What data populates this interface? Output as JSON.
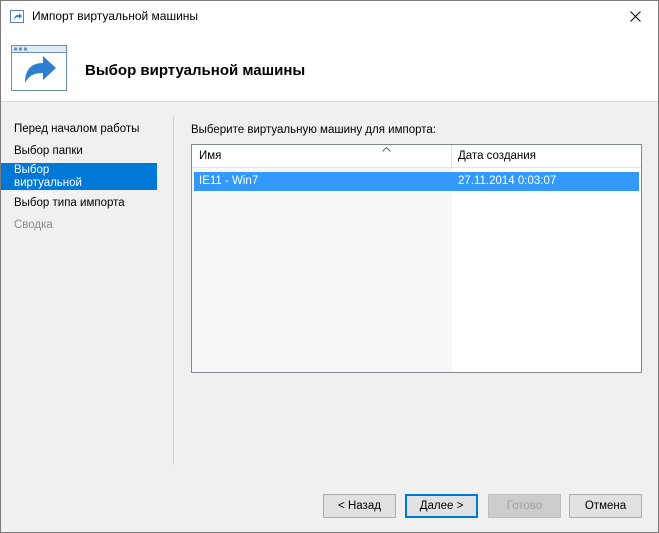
{
  "window": {
    "title": "Импорт виртуальной машины"
  },
  "header": {
    "title": "Выбор виртуальной машины"
  },
  "sidebar": {
    "steps": [
      {
        "label": "Перед началом работы",
        "state": "normal"
      },
      {
        "label": "Выбор папки",
        "state": "normal"
      },
      {
        "label": "Выбор виртуальной машины",
        "state": "active"
      },
      {
        "label": "Выбор типа импорта",
        "state": "normal"
      },
      {
        "label": "Сводка",
        "state": "disabled"
      }
    ]
  },
  "main": {
    "prompt": "Выберите виртуальную машину для импорта:",
    "list": {
      "columns": [
        "Имя",
        "Дата создания"
      ],
      "sorted_column": "Имя",
      "rows": [
        {
          "name": "IE11 - Win7",
          "created": "27.11.2014 0:03:07",
          "selected": true
        }
      ]
    }
  },
  "buttons": {
    "back": "< Назад",
    "next": "Далее >",
    "finish": "Готово",
    "cancel": "Отмена"
  },
  "colors": {
    "accent": "#0078d7",
    "selection": "#3399ff",
    "disabled_text": "#8a8a8a"
  },
  "icons": {
    "title": "import-arrow-icon",
    "header": "import-window-icon",
    "close": "close-icon",
    "sort": "sort-ascending-icon"
  }
}
